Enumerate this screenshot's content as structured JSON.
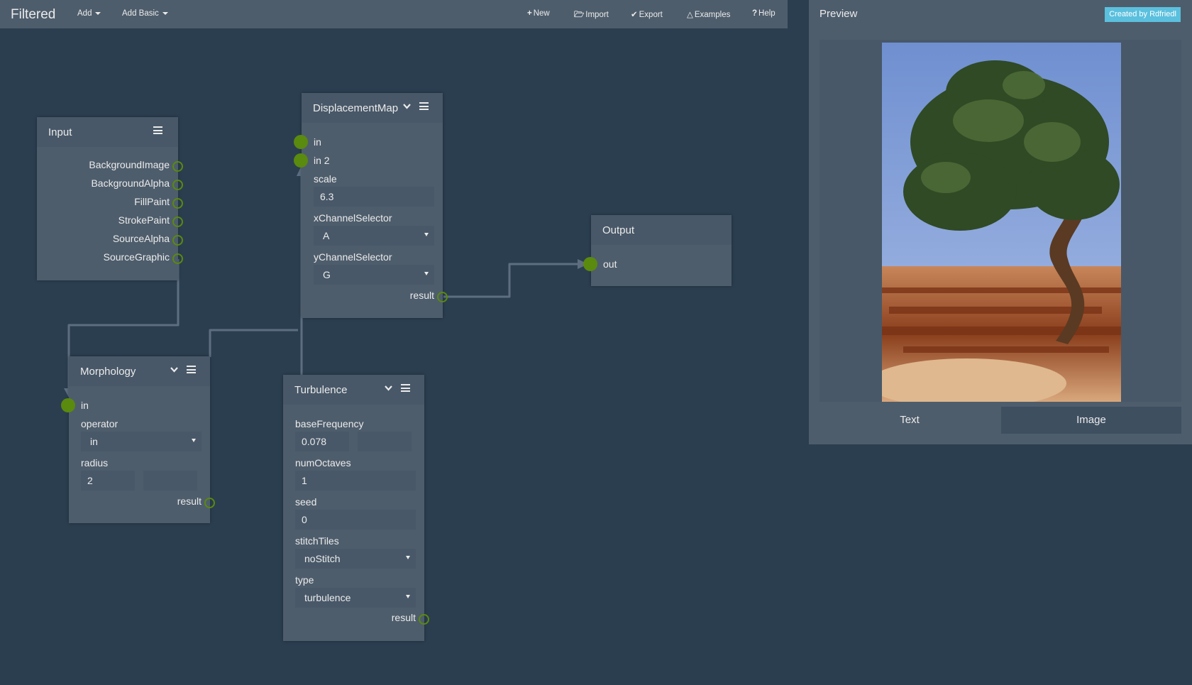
{
  "app": {
    "title": "Filtered"
  },
  "nav": {
    "add": "Add",
    "add_basic": "Add Basic",
    "new": "New",
    "import": "Import",
    "export": "Export",
    "examples": "Examples",
    "help": "Help"
  },
  "nodes": {
    "input": {
      "title": "Input",
      "outputs": [
        "BackgroundImage",
        "BackgroundAlpha",
        "FillPaint",
        "StrokePaint",
        "SourceAlpha",
        "SourceGraphic"
      ]
    },
    "displacement": {
      "title": "DisplacementMap",
      "in1": "in",
      "in2": "in 2",
      "scale_label": "scale",
      "scale_value": "6.3",
      "xchannel_label": "xChannelSelector",
      "xchannel_value": "A",
      "ychannel_label": "yChannelSelector",
      "ychannel_value": "G",
      "result": "result"
    },
    "output": {
      "title": "Output",
      "in": "out"
    },
    "morphology": {
      "title": "Morphology",
      "in": "in",
      "operator_label": "operator",
      "operator_value": "in",
      "radius_label": "radius",
      "radius_x": "2",
      "radius_y": "",
      "result": "result"
    },
    "turbulence": {
      "title": "Turbulence",
      "basefreq_label": "baseFrequency",
      "basefreq_x": "0.078",
      "basefreq_y": "",
      "octaves_label": "numOctaves",
      "octaves_value": "1",
      "seed_label": "seed",
      "seed_value": "0",
      "stitch_label": "stitchTiles",
      "stitch_value": "noStitch",
      "type_label": "type",
      "type_value": "turbulence",
      "result": "result"
    }
  },
  "preview": {
    "title": "Preview",
    "credit": "Created by Rdfriedl",
    "tabs": [
      "Text",
      "Image"
    ],
    "active_tab": "Image"
  },
  "colors": {
    "background": "#2b3e50",
    "panel": "#4e5d6c",
    "port": "#5a8a0e",
    "accent": "#5bc0de"
  }
}
